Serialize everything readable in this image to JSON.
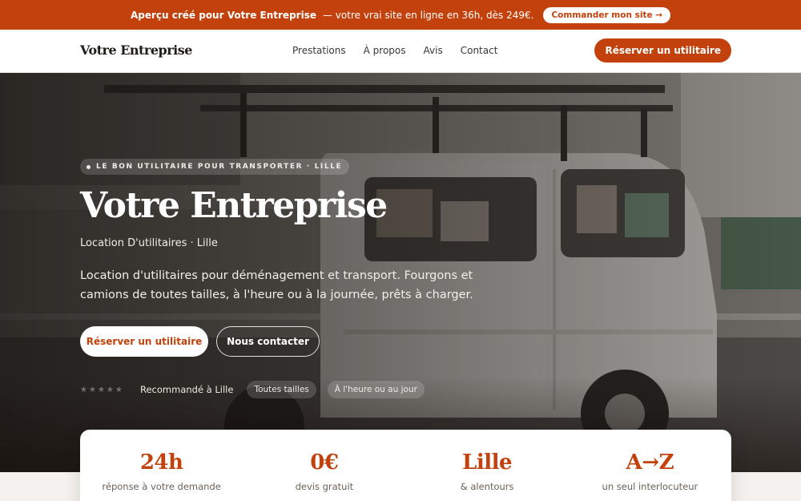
{
  "promo": {
    "bold": "Aperçu créé pour Votre Entreprise",
    "text": "— votre vrai site en ligne en 36h, dès 249€.",
    "cta": "Commander mon site →"
  },
  "nav": {
    "brand": "Votre Entreprise",
    "links": [
      "Prestations",
      "À propos",
      "Avis",
      "Contact"
    ],
    "cta": "Réserver un utilitaire"
  },
  "hero": {
    "eyebrow": "LE BON UTILITAIRE POUR TRANSPORTER · LILLE",
    "title": "Votre Entreprise",
    "subtitle": "Location D'utilitaires · Lille",
    "description": "Location d'utilitaires pour déménagement et transport. Fourgons et camions de toutes tailles, à l'heure ou à la journée, prêts à charger.",
    "primary_button": "Réserver un utilitaire",
    "secondary_button": "Nous contacter",
    "stars": "★★★★★",
    "recommended": "Recommandé à Lille",
    "tags": [
      "Toutes tailles",
      "À l'heure ou au jour"
    ]
  },
  "stats": [
    {
      "value": "24h",
      "label": "réponse à votre demande"
    },
    {
      "value": "0€",
      "label": "devis gratuit"
    },
    {
      "value": "Lille",
      "label": "& alentours"
    },
    {
      "value": "A→Z",
      "label": "un seul interlocuteur"
    }
  ],
  "colors": {
    "accent": "#c2410c",
    "hero_overlay": "#14100d"
  }
}
